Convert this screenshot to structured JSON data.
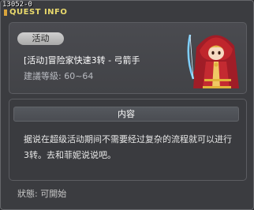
{
  "window": {
    "quest_id": "13052-0",
    "title": "QUEST INFO"
  },
  "quest": {
    "badge": "活动",
    "name": "[活动]冒险家快速3转 - 弓箭手",
    "level": "建議等級: 60~64"
  },
  "details": {
    "header": "内容",
    "description": "据说在超级活动期间不需要经过复杂的流程就可以进行3转。去和菲妮说说吧。"
  },
  "status": {
    "text": "狀態:  可開始"
  },
  "npc": {
    "icon": "hooded-archer-npc-icon",
    "hood_color": "#c0262c",
    "trim_color": "#e0b33a"
  }
}
